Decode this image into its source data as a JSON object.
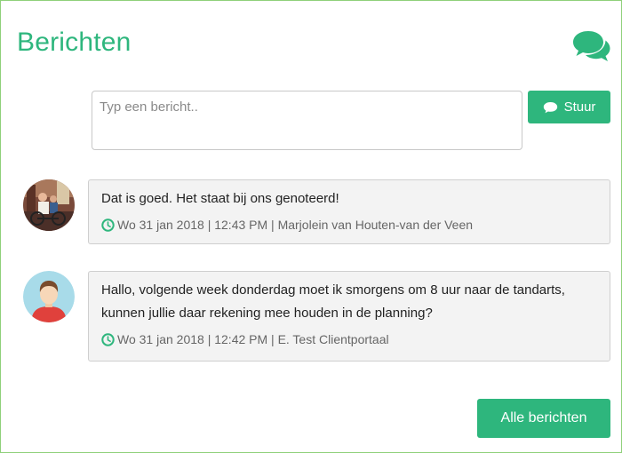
{
  "header": {
    "title": "Berichten",
    "icon": "chat-bubbles-icon"
  },
  "composer": {
    "placeholder": "Typ een bericht..",
    "value": "",
    "send_label": "Stuur",
    "send_icon": "speech-bubble-icon"
  },
  "messages": [
    {
      "text": "Dat is goed. Het staat bij ons genoteerd!",
      "meta": "Wo 31 jan 2018 | 12:43 PM | Marjolein van Houten-van der Veen",
      "avatar": "photo-avatar"
    },
    {
      "text": "Hallo, volgende week donderdag moet ik smorgens om 8 uur naar de tandarts, kunnen jullie daar rekening mee houden in de planning?",
      "meta": "Wo 31 jan 2018 | 12:42 PM | E. Test Clientportaal",
      "avatar": "default-user-avatar"
    }
  ],
  "footer": {
    "all_messages_label": "Alle berichten"
  },
  "colors": {
    "accent": "#2eb67d",
    "panel_border": "#8fd07a",
    "bubble_bg": "#f3f3f3"
  }
}
